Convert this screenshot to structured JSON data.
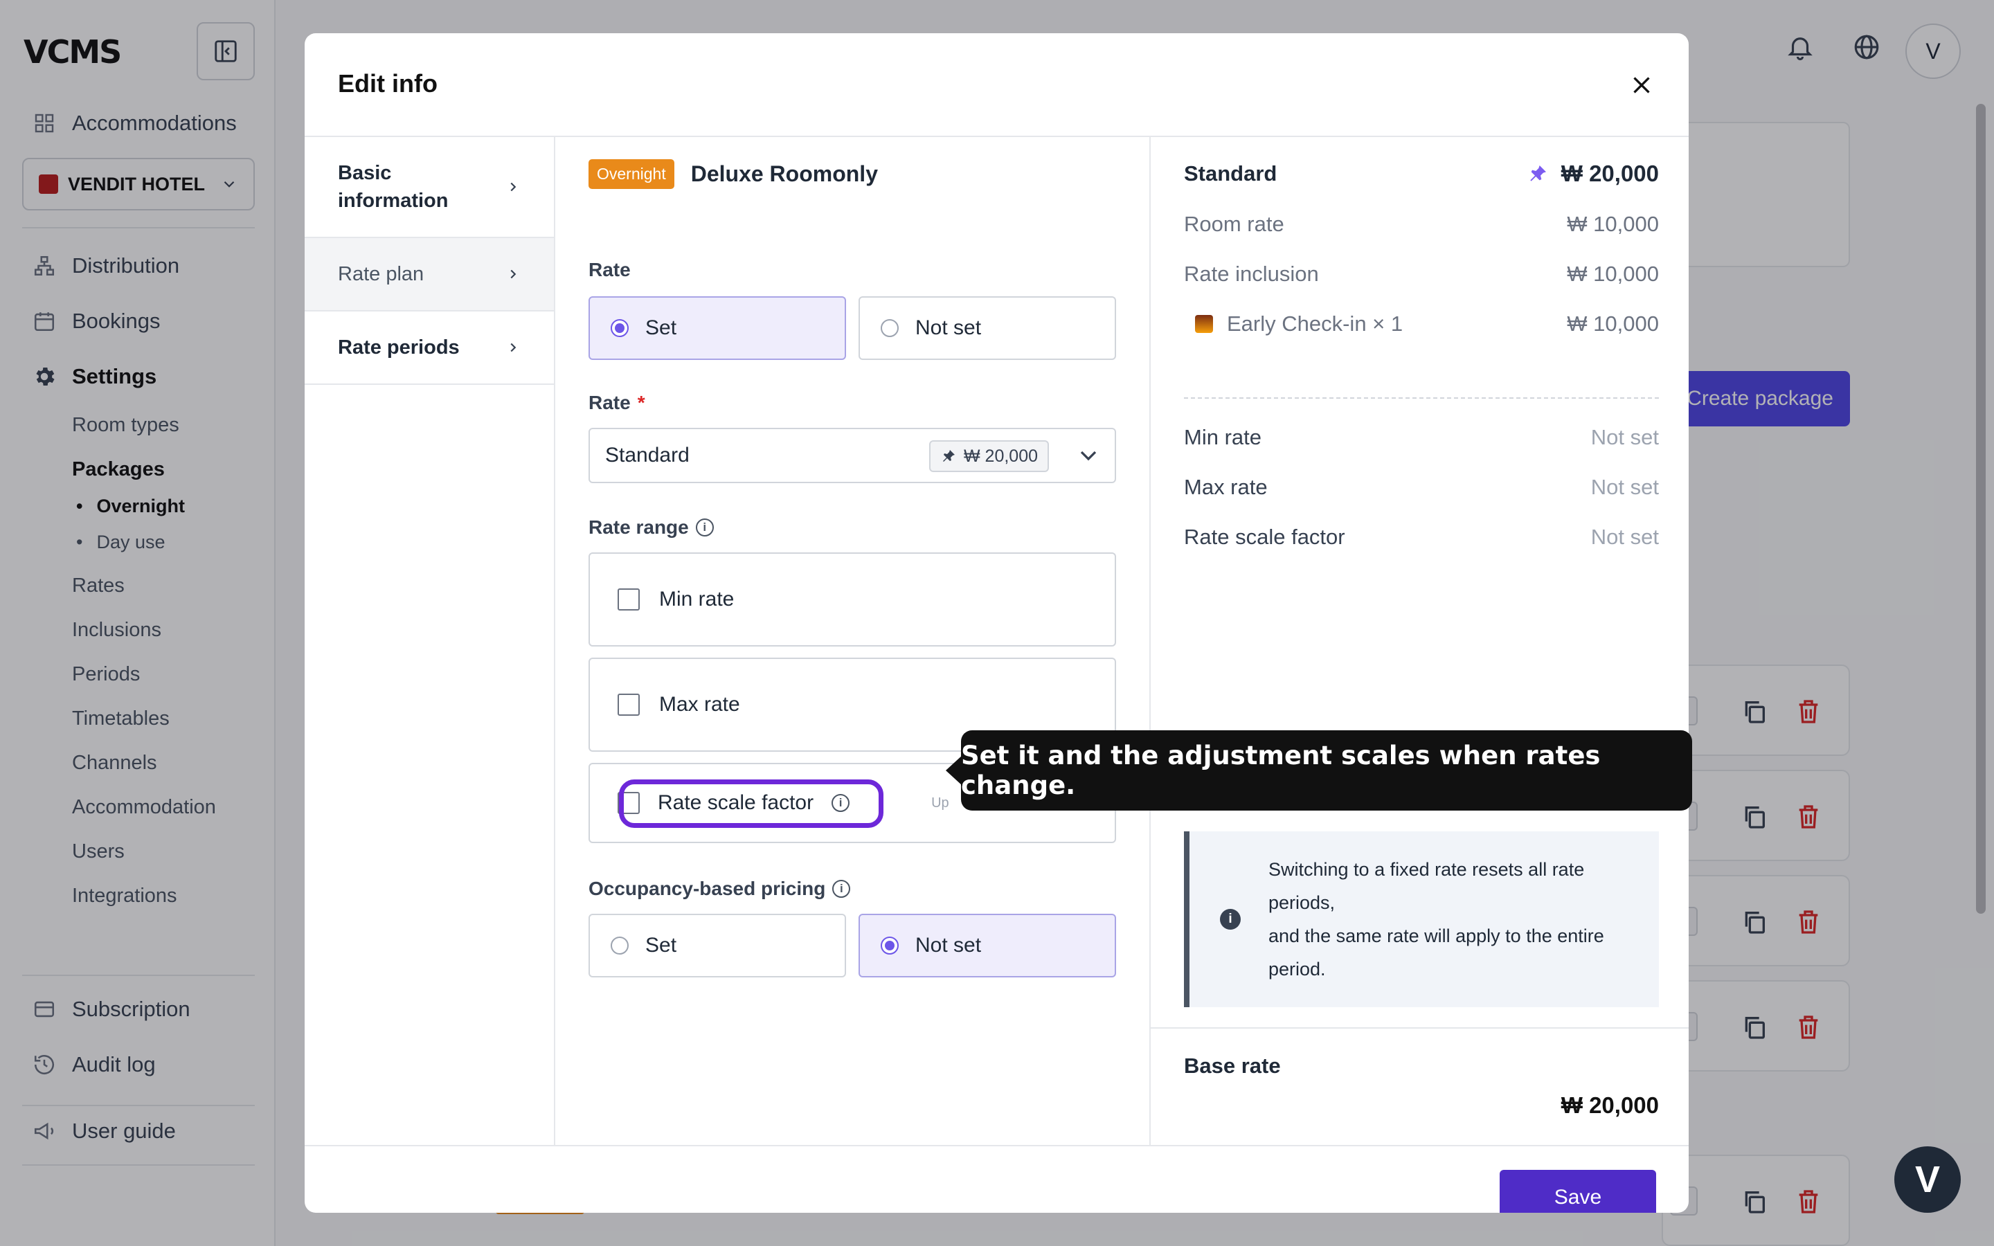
{
  "app": {
    "logo": "VCMS",
    "hotel": "VENDIT HOTEL",
    "nav": {
      "accommodations": "Accommodations",
      "distribution": "Distribution",
      "bookings": "Bookings",
      "settings": "Settings",
      "room_types": "Room types",
      "packages": "Packages",
      "overnight": "Overnight",
      "day_use": "Day use",
      "rates": "Rates",
      "inclusions": "Inclusions",
      "periods": "Periods",
      "timetables": "Timetables",
      "channels": "Channels",
      "accommodation": "Accommodation",
      "users": "Users",
      "integrations": "Integrations",
      "subscription": "Subscription",
      "audit_log": "Audit log",
      "user_guide": "User guide"
    },
    "avatar": "V",
    "create_package": "Create package",
    "fab": "V"
  },
  "modal": {
    "title": "Edit info",
    "left_nav": [
      "Basic information",
      "Rate plan",
      "Rate periods"
    ],
    "badge": "Overnight",
    "room_name": "Deluxe Roomonly",
    "rate_label": "Rate",
    "rate_options": {
      "set": "Set",
      "not_set": "Not set"
    },
    "rate_select_label": "Rate",
    "rate_select_value": "Standard",
    "rate_select_chip": "₩ 20,000",
    "rate_range_label": "Rate range",
    "min_rate": "Min rate",
    "max_rate": "Max rate",
    "rate_scale_factor": "Rate scale factor",
    "rate_scale_hint": "Up",
    "occupancy_label": "Occupancy-based pricing",
    "occupancy_options": {
      "set": "Set",
      "not_set": "Not set"
    },
    "summary": {
      "title": "Standard",
      "total": "₩ 20,000",
      "room_rate_label": "Room rate",
      "room_rate": "₩ 10,000",
      "inclusion_label": "Rate inclusion",
      "inclusion": "₩ 10,000",
      "early_checkin_label": "Early Check-in × 1",
      "early_checkin": "₩ 10,000",
      "min_rate_label": "Min rate",
      "min_rate": "Not set",
      "max_rate_label": "Max rate",
      "max_rate": "Not set",
      "scale_label": "Rate scale factor",
      "scale": "Not set"
    },
    "notice": {
      "line1": "Switching to a fixed rate resets all rate",
      "line2": "periods,",
      "line3": "and the same rate will apply to the entire",
      "line4": "period."
    },
    "base_rate_label": "Base rate",
    "base_rate": "₩ 20,000",
    "save": "Save"
  },
  "tooltip": "Set it and the adjustment scales when rates change.",
  "colors": {
    "accent": "#4f2cc7",
    "badge": "#e98a1a",
    "highlight": "#6d28d9"
  }
}
